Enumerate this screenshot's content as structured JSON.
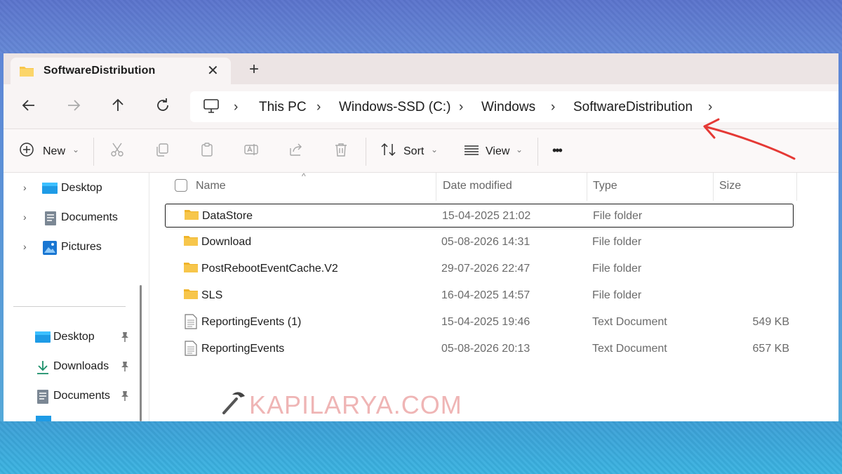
{
  "tab": {
    "title": "SoftwareDistribution",
    "close_glyph": "✕",
    "new_glyph": "+"
  },
  "breadcrumb": [
    "This PC",
    "Windows-SSD (C:)",
    "Windows",
    "SoftwareDistribution"
  ],
  "toolbar": {
    "new_label": "New",
    "sort_label": "Sort",
    "view_label": "View",
    "more_glyph": "•••"
  },
  "sidebar": {
    "top_items": [
      {
        "label": "Desktop",
        "icon": "desktop-icon"
      },
      {
        "label": "Documents",
        "icon": "documents-icon"
      },
      {
        "label": "Pictures",
        "icon": "pictures-icon"
      }
    ],
    "pinned_items": [
      {
        "label": "Desktop",
        "icon": "desktop-icon"
      },
      {
        "label": "Downloads",
        "icon": "downloads-icon"
      },
      {
        "label": "Documents",
        "icon": "documents-icon"
      }
    ]
  },
  "columns": {
    "name": "Name",
    "date": "Date modified",
    "type": "Type",
    "size": "Size"
  },
  "files": [
    {
      "name": "DataStore",
      "date": "15-04-2025 21:02",
      "type": "File folder",
      "size": "",
      "icon": "folder-icon",
      "selected": true
    },
    {
      "name": "Download",
      "date": "05-08-2026 14:31",
      "type": "File folder",
      "size": "",
      "icon": "folder-icon"
    },
    {
      "name": "PostRebootEventCache.V2",
      "date": "29-07-2026 22:47",
      "type": "File folder",
      "size": "",
      "icon": "folder-icon"
    },
    {
      "name": "SLS",
      "date": "16-04-2025 14:57",
      "type": "File folder",
      "size": "",
      "icon": "folder-icon"
    },
    {
      "name": "ReportingEvents (1)",
      "date": "15-04-2025 19:46",
      "type": "Text Document",
      "size": "549 KB",
      "icon": "text-document-icon"
    },
    {
      "name": "ReportingEvents",
      "date": "05-08-2026 20:13",
      "type": "Text Document",
      "size": "657 KB",
      "icon": "text-document-icon"
    }
  ],
  "watermark": "KAPILARYA.COM",
  "colors": {
    "accent": "#0067c0",
    "folder": "#f7c64b",
    "annotation_arrow": "#e53935"
  }
}
